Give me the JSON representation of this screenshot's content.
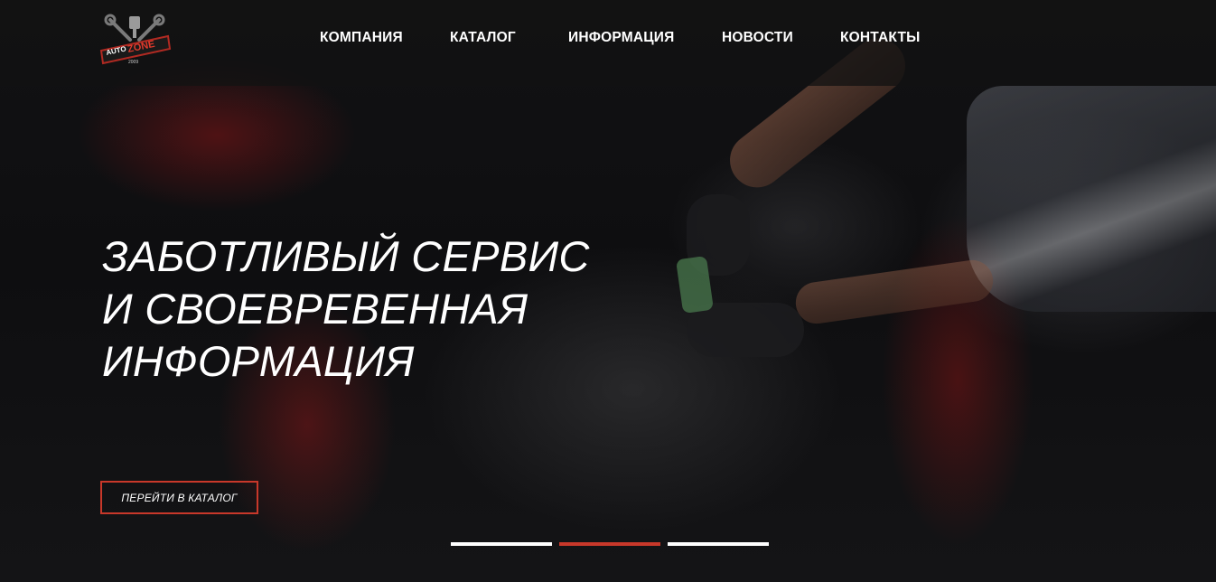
{
  "header": {
    "logo": {
      "top_text": "AUTO",
      "main_text": "ZONE",
      "year": "2009"
    },
    "nav": [
      {
        "label": "КОМПАНИЯ"
      },
      {
        "label": "КАТАЛОГ"
      },
      {
        "label": "ИНФОРМАЦИЯ"
      },
      {
        "label": "НОВОСТИ"
      },
      {
        "label": "КОНТАКТЫ"
      }
    ]
  },
  "hero": {
    "headline_lines": [
      "ЗАБОТЛИВЫЙ СЕРВИС",
      "И СВОЕВРЕВЕННАЯ",
      "ИНФОРМАЦИЯ"
    ],
    "cta_label": "ПЕРЕЙТИ В КАТАЛОГ",
    "slider": {
      "total": 3,
      "active": 2
    }
  },
  "colors": {
    "accent": "#c8382a",
    "dot_inactive": "#ffffff",
    "header_bg": "#121212",
    "text": "#ffffff"
  }
}
